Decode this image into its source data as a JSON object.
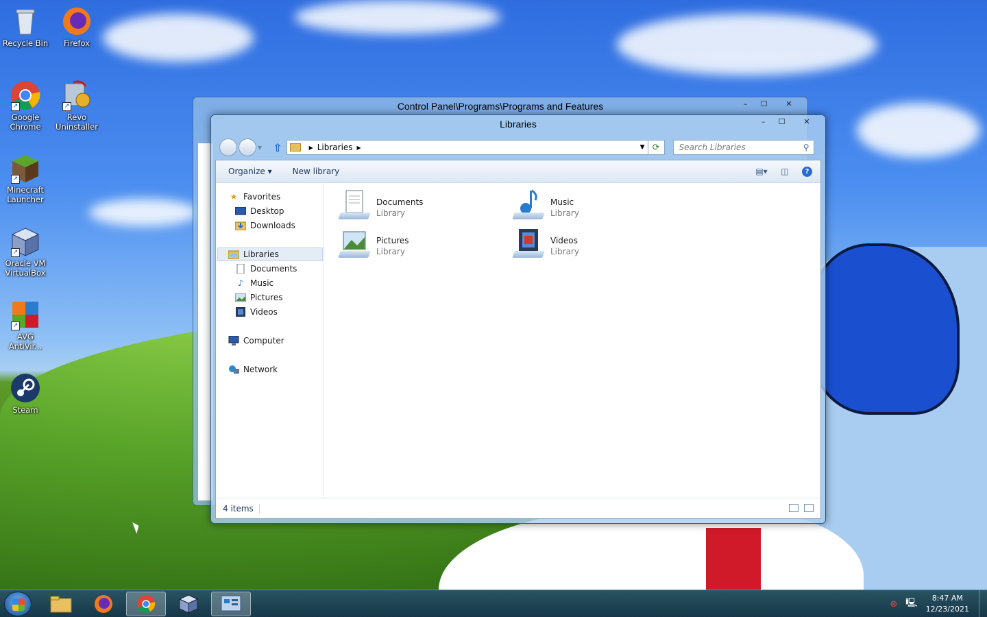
{
  "desktop": {
    "icons": [
      {
        "label": "Recycle Bin",
        "icon": "recycle-bin-icon"
      },
      {
        "label": "Firefox",
        "icon": "firefox-icon"
      },
      {
        "label": "Google Chrome",
        "icon": "chrome-icon"
      },
      {
        "label": "Revo Uninstaller",
        "icon": "revo-icon"
      },
      {
        "label": "Minecraft Launcher",
        "icon": "minecraft-icon"
      },
      {
        "label": "Oracle VM VirtualBox",
        "icon": "virtualbox-icon"
      },
      {
        "label": "AVG AntiVir...",
        "icon": "avg-icon"
      },
      {
        "label": "Steam",
        "icon": "steam-icon"
      }
    ]
  },
  "back_window": {
    "title": "Control Panel\\Programs\\Programs and Features"
  },
  "window": {
    "title": "Libraries",
    "caption": {
      "minimize": "–",
      "maximize": "☐",
      "close": "✕"
    },
    "address": {
      "crumb": "Libraries"
    },
    "search": {
      "placeholder": "Search Libraries"
    },
    "toolbar": {
      "organize": "Organize ▾",
      "new_library": "New library"
    },
    "nav": {
      "favorites": "Favorites",
      "desktop": "Desktop",
      "downloads": "Downloads",
      "libraries": "Libraries",
      "documents": "Documents",
      "music": "Music",
      "pictures": "Pictures",
      "videos": "Videos",
      "computer": "Computer",
      "network": "Network"
    },
    "items": [
      {
        "name": "Documents",
        "type": "Library"
      },
      {
        "name": "Music",
        "type": "Library"
      },
      {
        "name": "Pictures",
        "type": "Library"
      },
      {
        "name": "Videos",
        "type": "Library"
      }
    ],
    "status": {
      "count": "4 items"
    }
  },
  "taskbar": {
    "clock": {
      "time": "8:47 AM",
      "date": "12/23/2021"
    }
  },
  "colors": {
    "accent": "#1a4fd0",
    "window_frame": "#2d5a8e"
  }
}
